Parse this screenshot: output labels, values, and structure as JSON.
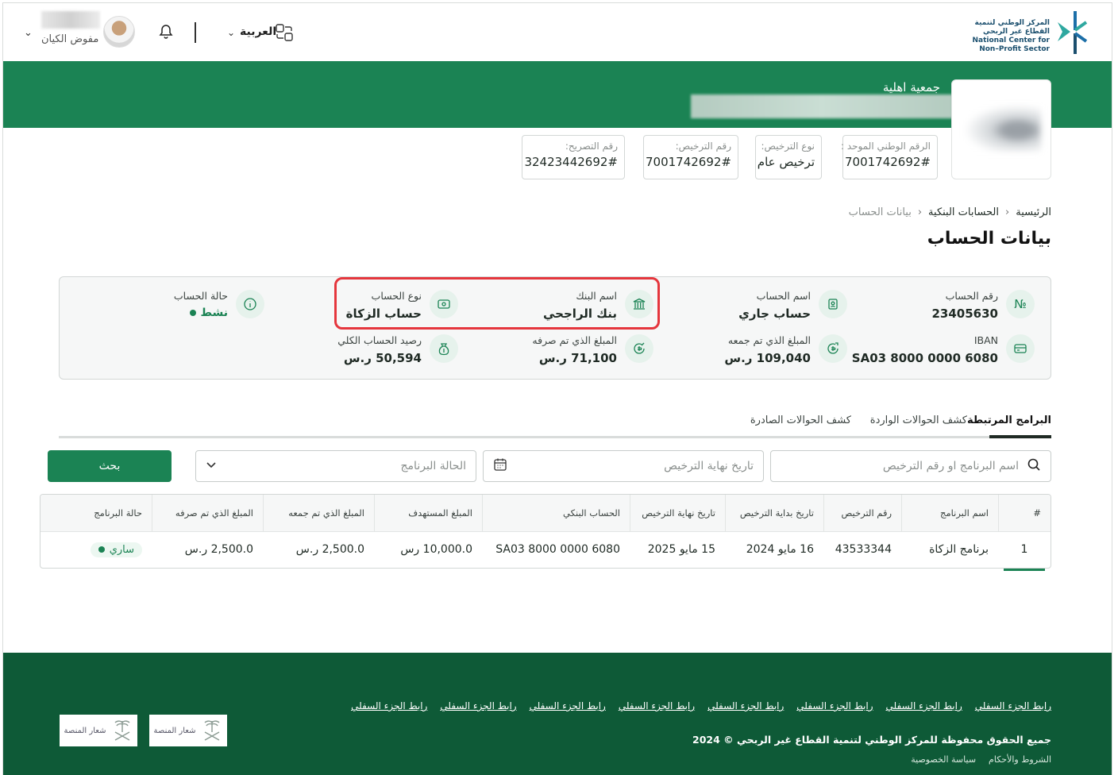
{
  "header": {
    "language_label": "العربية",
    "user_role": "مفوض الكيان",
    "logo": {
      "line1": "المركز الوطني لتنمية",
      "line2": "القطاع غير الربحي",
      "line3": "National Center for",
      "line4": "Non–Profit Sector"
    },
    "icons": [
      "language-icon",
      "chevron-down-icon",
      "bell-icon",
      "avatar",
      "chevron-down-icon"
    ]
  },
  "entity": {
    "type_label": "جمعية اهلية",
    "chips": [
      {
        "label": "الرقم الوطني الموحد :",
        "value": "7001742692#"
      },
      {
        "label": "نوع الترخيص:",
        "value": "ترخيص عام"
      },
      {
        "label": "رقم الترخيص:",
        "value": "7001742692#"
      },
      {
        "label": "رقم التصريح:",
        "value": "32423442692#"
      }
    ]
  },
  "breadcrumb": {
    "home": "الرئيسية",
    "bank_accounts": "الحسابات البنكية",
    "current": "بيانات الحساب"
  },
  "page_title": "بيانات الحساب",
  "account": {
    "number_label": "رقم الحساب",
    "number_value": "23405630",
    "name_label": "اسم الحساب",
    "name_value": "حساب جاري",
    "bank_label": "اسم البنك",
    "bank_value": "بنك الراجحي",
    "type_label": "نوع الحساب",
    "type_value": "حساب الزكاة",
    "status_label": "حالة الحساب",
    "status_value": "نشط",
    "iban_label": "IBAN",
    "iban_value": "SA03 8000 0000 6080",
    "collected_label": "المبلغ الذي تم جمعه",
    "collected_value": "109,040 ر.س",
    "spent_label": "المبلغ الذي تم صرفه",
    "spent_value": "71,100 ر.س",
    "balance_label": "رصيد الحساب الكلي",
    "balance_value": "50,594 ر.س"
  },
  "tabs": [
    "البرامج المرتبطة",
    "كشف الحوالات الواردة",
    "كشف الحوالات الصادرة"
  ],
  "filters": {
    "search_placeholder": "اسم البرنامج او رقم الترخيص",
    "date_placeholder": "تاريخ نهاية الترخيص",
    "status_placeholder": "الحالة البرنامج",
    "search_button": "بحث"
  },
  "table": {
    "headers": [
      "#",
      "اسم البرنامج",
      "رقم الترخيص",
      "تاريخ بداية الترخيص",
      "تاريخ نهاية الترخيص",
      "الحساب البنكي",
      "المبلغ المستهدف",
      "المبلغ الذي تم جمعه",
      "المبلغ الذي تم صرفه",
      "حالة البرنامج"
    ],
    "rows": [
      [
        "1",
        "برنامج الزكاة",
        "43533344",
        "16 مايو 2024",
        "15 مايو 2025",
        "SA03 8000 0000 6080",
        "10,000.0 رس",
        "2,500.0 ر.س",
        "2,500.0 ر.س",
        "ساري"
      ]
    ]
  },
  "footer": {
    "links": [
      "رابط الجزء السفلي",
      "رابط الجزء السفلي",
      "رابط الجزء السفلي",
      "رابط الجزء السفلي",
      "رابط الجزء السفلي",
      "رابط الجزء السفلي",
      "رابط الجزء السفلي",
      "رابط الجزء السفلي"
    ],
    "copyright": "جميع الحقوق محفوظة للمركز الوطني لتنمية القطاع غير الربحي © 2024",
    "terms": "الشروط والأحكام",
    "privacy": "سياسة الخصوصية",
    "emblem1": "شعار المنصة",
    "emblem2": "شعار المنصة"
  },
  "colors": {
    "brand": "#1b8354",
    "footer": "#0e5a37",
    "highlight": "#e5363d"
  }
}
